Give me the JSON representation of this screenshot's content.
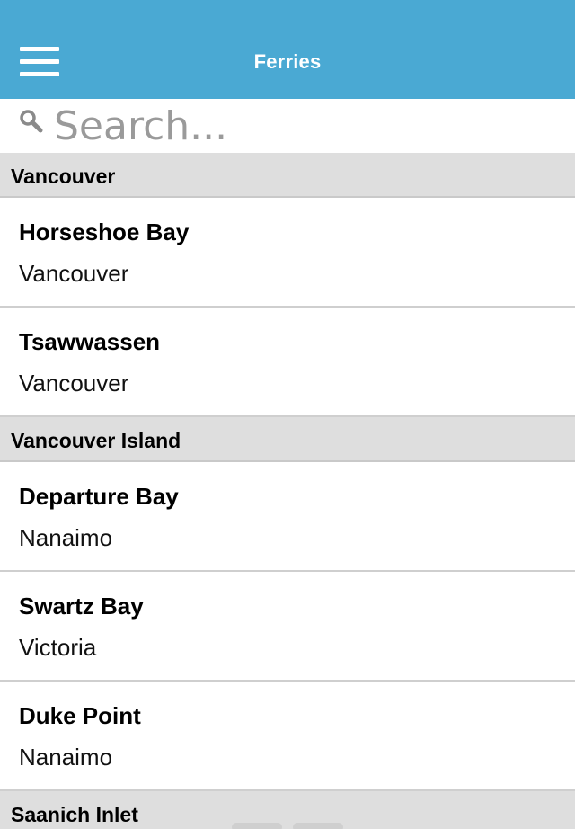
{
  "header": {
    "title": "Ferries",
    "menu_icon": "hamburger-menu-icon",
    "background_color": "#4aa9d3"
  },
  "search": {
    "placeholder": "Search...",
    "value": "",
    "icon": "search-icon"
  },
  "sections": [
    {
      "label": "Vancouver",
      "items": [
        {
          "title": "Horseshoe Bay",
          "subtitle": "Vancouver"
        },
        {
          "title": "Tsawwassen",
          "subtitle": "Vancouver"
        }
      ]
    },
    {
      "label": "Vancouver Island",
      "items": [
        {
          "title": "Departure Bay",
          "subtitle": "Nanaimo"
        },
        {
          "title": "Swartz Bay",
          "subtitle": "Victoria"
        },
        {
          "title": "Duke Point",
          "subtitle": "Nanaimo"
        }
      ]
    },
    {
      "label": "Saanich Inlet",
      "items": []
    }
  ]
}
